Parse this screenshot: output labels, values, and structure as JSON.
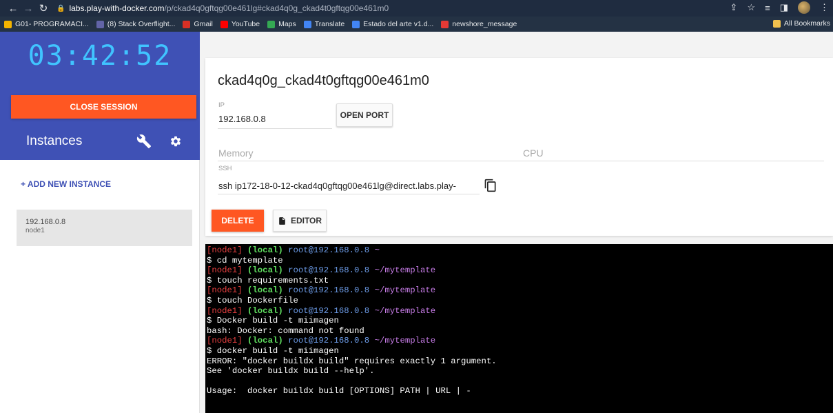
{
  "browser": {
    "url_host": "labs.play-with-docker.com",
    "url_path": "/p/ckad4q0gftqg00e461lg#ckad4q0g_ckad4t0gftqg00e461m0",
    "bookmarks": [
      {
        "label": "G01- PROGRAMACI...",
        "icon": "drive-icon",
        "color": "#f4b400"
      },
      {
        "label": "(8) Stack Overflight...",
        "icon": "teams-icon",
        "color": "#6264a7"
      },
      {
        "label": "Gmail",
        "icon": "gmail-icon",
        "color": "#d93025"
      },
      {
        "label": "YouTube",
        "icon": "youtube-icon",
        "color": "#ff0000"
      },
      {
        "label": "Maps",
        "icon": "maps-icon",
        "color": "#34a853"
      },
      {
        "label": "Translate",
        "icon": "translate-icon",
        "color": "#4285f4"
      },
      {
        "label": "Estado del arte v1.d...",
        "icon": "docs-icon",
        "color": "#4285f4"
      },
      {
        "label": "newshore_message",
        "icon": "newshore-icon",
        "color": "#e53935"
      }
    ],
    "all_bookmarks": "All Bookmarks"
  },
  "sidebar": {
    "timer": "03:42:52",
    "close_session": "CLOSE SESSION",
    "instances_title": "Instances",
    "add_instance": "+ ADD NEW INSTANCE",
    "instance": {
      "ip": "192.168.0.8",
      "name": "node1"
    }
  },
  "main": {
    "title": "ckad4q0g_ckad4t0gftqg00e461m0",
    "ip_label": "IP",
    "ip_value": "192.168.0.8",
    "open_port": "OPEN PORT",
    "memory_label": "Memory",
    "cpu_label": "CPU",
    "ssh_label": "SSH",
    "ssh_value": "ssh ip172-18-0-12-ckad4q0gftqg00e461lg@direct.labs.play-",
    "delete": "DELETE",
    "editor": "EDITOR"
  },
  "colors": {
    "sidebar_blue": "#3f51b5",
    "timer": "#40c4ff",
    "accent_orange": "#ff5722"
  },
  "terminal": {
    "prompt_node": "[node1]",
    "prompt_local": "(local)",
    "prompt_user": "root@192.168.0.8",
    "lines": [
      {
        "type": "prompt",
        "path": "~"
      },
      {
        "type": "text",
        "text": "$ cd mytemplate"
      },
      {
        "type": "prompt",
        "path": "~/mytemplate"
      },
      {
        "type": "text",
        "text": "$ touch requirements.txt"
      },
      {
        "type": "prompt",
        "path": "~/mytemplate"
      },
      {
        "type": "text",
        "text": "$ touch Dockerfile"
      },
      {
        "type": "prompt",
        "path": "~/mytemplate"
      },
      {
        "type": "text",
        "text": "$ Docker build -t miimagen"
      },
      {
        "type": "text",
        "text": "bash: Docker: command not found"
      },
      {
        "type": "prompt",
        "path": "~/mytemplate"
      },
      {
        "type": "text",
        "text": "$ docker build -t miimagen"
      },
      {
        "type": "text",
        "text": "ERROR: \"docker buildx build\" requires exactly 1 argument."
      },
      {
        "type": "text",
        "text": "See 'docker buildx build --help'."
      },
      {
        "type": "text",
        "text": ""
      },
      {
        "type": "text",
        "text": "Usage:  docker buildx build [OPTIONS] PATH | URL | -"
      }
    ]
  }
}
